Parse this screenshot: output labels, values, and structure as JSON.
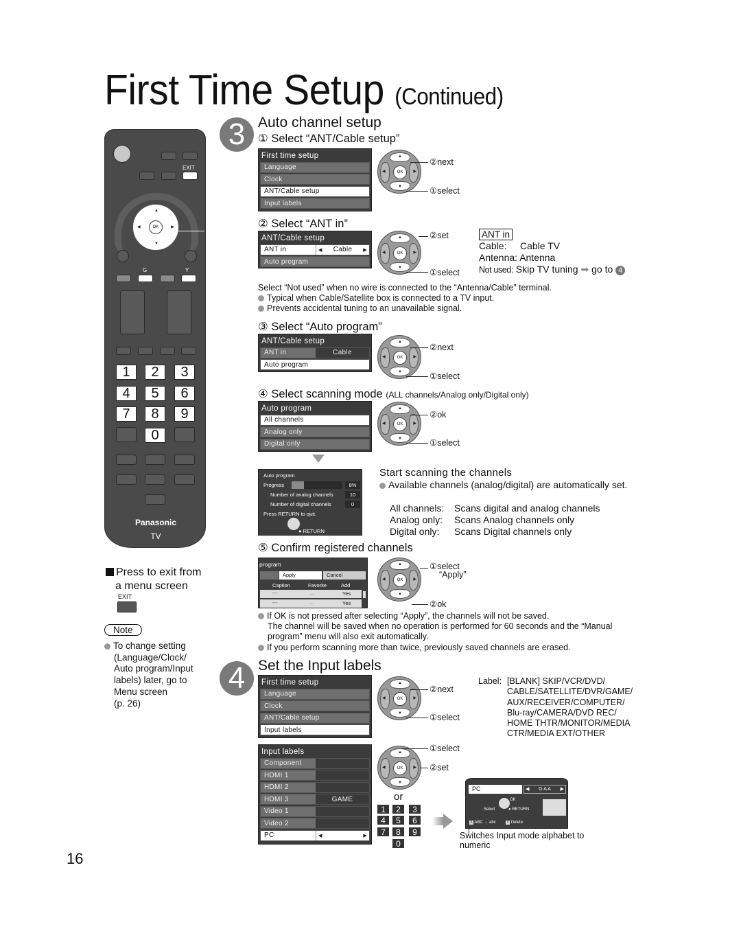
{
  "page": {
    "title": "First Time Setup",
    "title_suffix": "(Continued)",
    "page_number": "16"
  },
  "remote": {
    "brand": "Panasonic",
    "model_label": "TV",
    "exit_label": "EXIT",
    "ok_label": "OK",
    "g_label": "G",
    "y_label": "Y",
    "number_keys": [
      "1",
      "2",
      "3",
      "4",
      "5",
      "6",
      "7",
      "8",
      "9",
      "0"
    ]
  },
  "exit_note": {
    "text_line1": "Press to exit from",
    "text_line2": "a menu screen",
    "exit_label": "EXIT"
  },
  "note": {
    "label": "Note",
    "lines": [
      "To change setting",
      "(Language/Clock/",
      "Auto program/Input",
      "labels) later, go to",
      "Menu screen",
      "(p. 26)"
    ]
  },
  "step3": {
    "number": "3",
    "title": "Auto channel setup",
    "sub1": {
      "heading": "① Select “ANT/Cable setup”",
      "menu_title": "First time setup",
      "items": [
        "Language",
        "Clock",
        "ANT/Cable setup",
        "Input labels"
      ],
      "selected_index": 2,
      "callout_next": "②next",
      "callout_select": "①select"
    },
    "sub2": {
      "heading": "② Select “ANT in”",
      "menu_title": "ANT/Cable setup",
      "row1_label": "ANT in",
      "row1_value": "Cable",
      "row2_label": "Auto program",
      "callout_set": "②set",
      "callout_select": "①select",
      "ant_in_box": "ANT in",
      "options": [
        {
          "key": "Cable:",
          "value": "Cable TV"
        },
        {
          "key": "Antenna:",
          "value": "Antenna"
        },
        {
          "key": "Not used:",
          "value": "Skip TV tuning",
          "goto": "go to",
          "goto_step": "4"
        }
      ],
      "note": "Select “Not used” when no wire is connected to the “Antenna/Cable” terminal.",
      "bullets": [
        "Typical when Cable/Satellite box is connected to a TV input.",
        "Prevents accidental tuning to an unavailable signal."
      ]
    },
    "sub3": {
      "heading": "③ Select “Auto program”",
      "menu_title": "ANT/Cable setup",
      "row1_label": "ANT in",
      "row1_value": "Cable",
      "row2_label": "Auto program",
      "callout_next": "②next",
      "callout_select": "①select"
    },
    "sub4": {
      "heading": "④ Select scanning mode",
      "heading_small": "(ALL channels/Analog only/Digital only)",
      "menu_title": "Auto program",
      "items": [
        "All channels",
        "Analog only",
        "Digital only"
      ],
      "selected_index": 0,
      "callout_ok": "②ok",
      "callout_select": "①select"
    },
    "scan": {
      "osd_title": "Auto program",
      "progress_label": "Progress",
      "progress_value": "8%",
      "progress_fraction": 0.08,
      "analog_label": "Number of analog channels",
      "analog_value": "10",
      "digital_label": "Number of digital channels",
      "digital_value": "0",
      "return_hint": "Press RETURN to quit.",
      "return_label": "RETURN",
      "heading": "Start scanning the channels",
      "bullet": "Available channels (analog/digital) are automatically set.",
      "modes": [
        {
          "key": "All channels:",
          "value": "Scans digital and analog channels"
        },
        {
          "key": "Analog only:",
          "value": "Scans Analog channels only"
        },
        {
          "key": "Digital only:",
          "value": "Scans Digital channels only"
        }
      ]
    },
    "sub5": {
      "heading": "⑤ Confirm registered channels",
      "menu_title": "program",
      "apply_label": "Apply",
      "cancel_label": "Cancel",
      "columns": [
        "Caption",
        "Favorite",
        "Add"
      ],
      "rows": [
        {
          "caption": "---",
          "favorite": "...",
          "add": "Yes"
        },
        {
          "caption": "---",
          "favorite": "...",
          "add": "Yes"
        }
      ],
      "callout_select": "①select",
      "callout_select2": "“Apply”",
      "callout_ok": "②ok",
      "bullets": [
        "If OK is not pressed after selecting “Apply”, the channels will not be saved.",
        "If you perform scanning more than twice, previously saved channels are erased."
      ],
      "bullet1_cont1": "The channel will be saved when no operation is performed for 60 seconds and the “Manual",
      "bullet1_cont2": "program” menu will also exit automatically."
    }
  },
  "step4": {
    "number": "4",
    "title": "Set the Input labels",
    "menu1": {
      "title": "First time setup",
      "items": [
        "Language",
        "Clock",
        "ANT/Cable setup",
        "Input labels"
      ],
      "selected_index": 3,
      "callout_next": "②next",
      "callout_select": "①select"
    },
    "label_list": {
      "key": "Label:",
      "lines": [
        "[BLANK] SKIP/VCR/DVD/",
        "CABLE/SATELLITE/DVR/GAME/",
        "AUX/RECEIVER/COMPUTER/",
        "Blu-ray/CAMERA/DVD REC/",
        "HOME THTR/MONITOR/MEDIA",
        "CTR/MEDIA EXT/OTHER"
      ]
    },
    "menu2": {
      "title": "Input labels",
      "rows": [
        {
          "label": "Component",
          "value": ""
        },
        {
          "label": "HDMI 1",
          "value": ""
        },
        {
          "label": "HDMI 2",
          "value": ""
        },
        {
          "label": "HDMI 3",
          "value": "GAME"
        },
        {
          "label": "Video 1",
          "value": ""
        },
        {
          "label": "Video 2",
          "value": ""
        },
        {
          "label": "PC",
          "value": ""
        }
      ],
      "selected_index": 6,
      "callout_select": "①select",
      "callout_set": "②set",
      "or_label": "or"
    },
    "edit_screen": {
      "field_value": "PC",
      "chars": "G A A",
      "ok_label": "OK",
      "select_label": "Select",
      "return_label": "RETURN",
      "abc_label": "ABC → abc",
      "delete_label": "Delete",
      "caption": "Switches Input mode alphabet to",
      "caption2": "numeric"
    }
  }
}
